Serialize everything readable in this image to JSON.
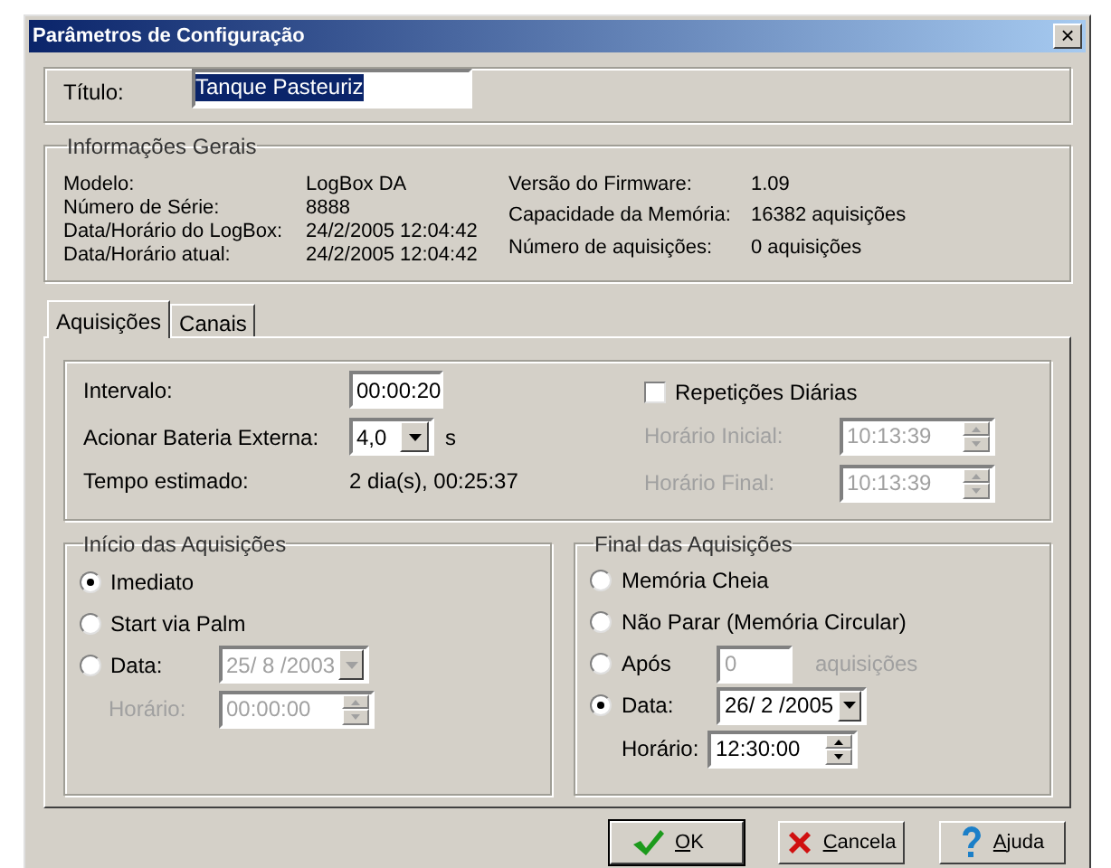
{
  "window": {
    "title": "Parâmetros de Configuração",
    "close": "×"
  },
  "title_field": {
    "label": "Título:",
    "value": "Tanque Pasteuriz",
    "selected": true
  },
  "info": {
    "title": "Informações Gerais",
    "left": [
      {
        "label": "Modelo:",
        "value": "LogBox DA"
      },
      {
        "label": "Número de Série:",
        "value": "8888"
      },
      {
        "label": "Data/Horário do LogBox:",
        "value": "24/2/2005 12:04:42"
      },
      {
        "label": "Data/Horário atual:",
        "value": "24/2/2005 12:04:42"
      }
    ],
    "right": [
      {
        "label": "Versão do Firmware:",
        "value": "1.09"
      },
      {
        "label": "Capacidade da Memória:",
        "value": "16382 aquisições"
      },
      {
        "label": "Número de aquisições:",
        "value": "0 aquisições"
      }
    ]
  },
  "tabs": [
    {
      "label": "Aquisições",
      "selected": true
    },
    {
      "label": "Canais",
      "selected": false
    }
  ],
  "acquisition": {
    "interval": {
      "label": "Intervalo:",
      "value": "00:00:20"
    },
    "battery": {
      "label": "Acionar Bateria Externa:",
      "value": "4,0",
      "unit": "s"
    },
    "estimated": {
      "label": "Tempo estimado:",
      "value": "2 dia(s), 00:25:37"
    },
    "daily_repeat": {
      "label": "Repetições Diárias",
      "checked": false
    },
    "start_time": {
      "label": "Horário Inicial:",
      "value": "10:13:39",
      "disabled": true
    },
    "end_time": {
      "label": "Horário Final:",
      "value": "10:13:39",
      "disabled": true
    }
  },
  "start": {
    "title": "Início das Aquisições",
    "options": [
      {
        "label": "Imediato",
        "selected": true
      },
      {
        "label": "Start via Palm",
        "selected": false
      },
      {
        "label": "Data:",
        "selected": false
      }
    ],
    "date": {
      "value": "25/ 8 /2003",
      "disabled": true
    },
    "time": {
      "label": "Horário:",
      "value": "00:00:00",
      "disabled": true
    }
  },
  "end": {
    "title": "Final das Aquisições",
    "options": [
      {
        "label": "Memória Cheia",
        "selected": false
      },
      {
        "label": "Não Parar (Memória Circular)",
        "selected": false
      },
      {
        "label": "Após",
        "selected": false
      },
      {
        "label": "Data:",
        "selected": true
      }
    ],
    "count": {
      "value": "0",
      "unit": "aquisições",
      "disabled": true
    },
    "date": {
      "value": "26/ 2 /2005",
      "disabled": false
    },
    "time": {
      "label": "Horário:",
      "value": "12:30:00",
      "disabled": false
    }
  },
  "buttons": [
    {
      "label": "OK",
      "kind": "ok"
    },
    {
      "label": "Cancela",
      "kind": "cancel"
    },
    {
      "label": "Ajuda",
      "kind": "help"
    }
  ]
}
